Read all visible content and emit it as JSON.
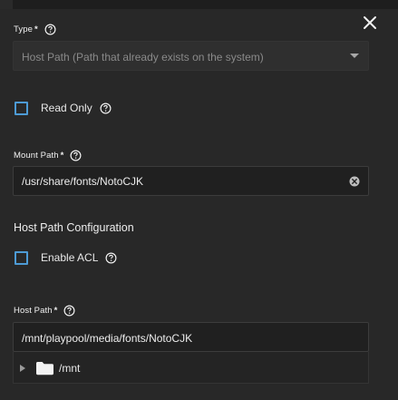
{
  "dialog": {
    "close_icon": "close-icon"
  },
  "type_field": {
    "label": "Type",
    "required_mark": "*",
    "value": "Host Path (Path that already exists on the system)",
    "help_icon": "help-circle-icon",
    "dropdown_icon": "caret-down-icon"
  },
  "read_only": {
    "label": "Read Only",
    "checked": false,
    "help_icon": "help-circle-icon"
  },
  "mount_path": {
    "label": "Mount Path",
    "required_mark": "*",
    "value": "/usr/share/fonts/NotoCJK",
    "clear_icon": "clear-circle-icon"
  },
  "host_path_config": {
    "title": "Host Path Configuration"
  },
  "enable_acl": {
    "label": "Enable ACL",
    "checked": false,
    "help_icon": "help-circle-icon"
  },
  "host_path": {
    "label": "Host Path",
    "required_mark": "*",
    "value": "/mnt/playpool/media/fonts/NotoCJK",
    "tree": [
      {
        "label": "/mnt",
        "icon": "folder-icon",
        "expanded": false
      }
    ]
  },
  "colors": {
    "background": "#282828",
    "accent": "#4d9bd5",
    "text": "#e6e6e6",
    "muted_text": "#8a8a8a"
  }
}
